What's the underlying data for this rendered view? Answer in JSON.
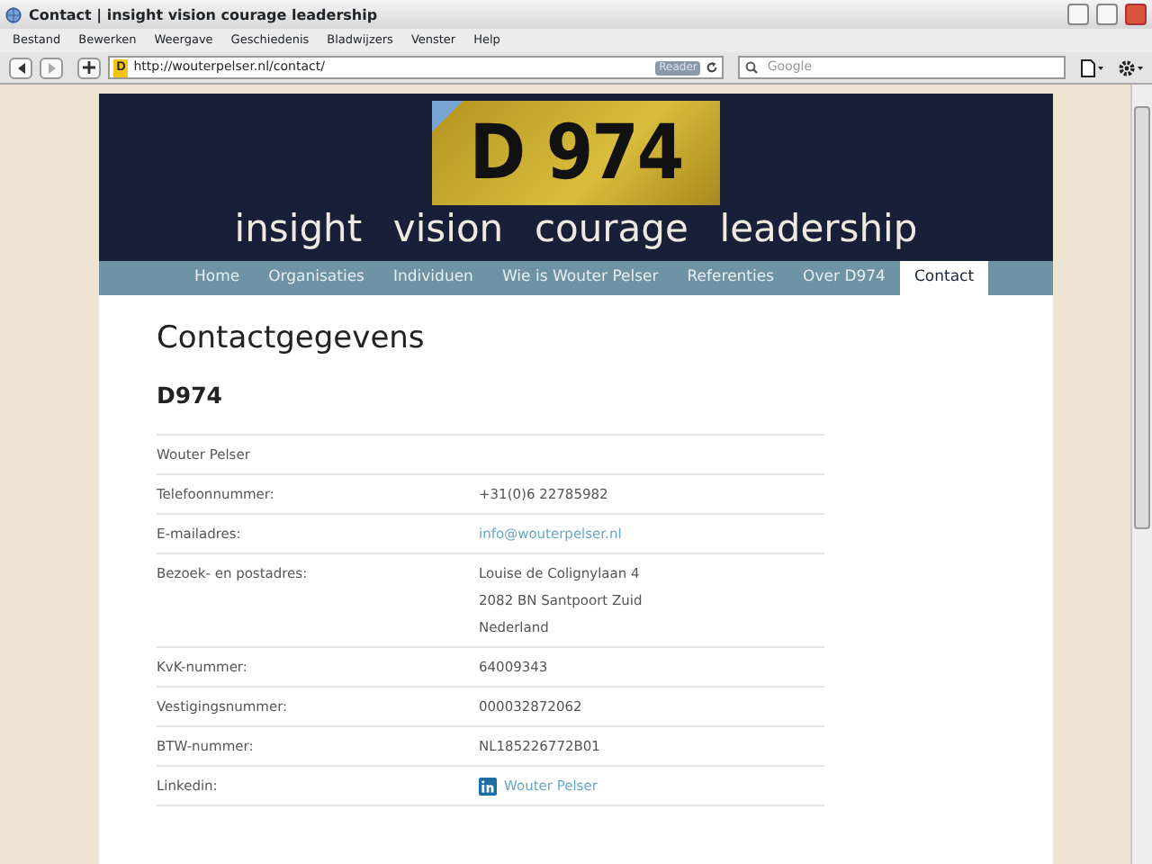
{
  "window": {
    "title": "Contact | insight  vision  courage  leadership"
  },
  "menu": [
    "Bestand",
    "Bewerken",
    "Weergave",
    "Geschiedenis",
    "Bladwijzers",
    "Venster",
    "Help"
  ],
  "toolbar": {
    "site_letter": "D",
    "url": "http://wouterpelser.nl/contact/",
    "reader": "Reader",
    "search_placeholder": "Google"
  },
  "header": {
    "logo_text": "D 974",
    "tagline": "insight  vision  courage  leadership"
  },
  "nav": [
    {
      "label": "Home",
      "selected": false
    },
    {
      "label": "Organisaties",
      "selected": false
    },
    {
      "label": "Individuen",
      "selected": false
    },
    {
      "label": "Wie is Wouter Pelser",
      "selected": false
    },
    {
      "label": "Referenties",
      "selected": false
    },
    {
      "label": "Over D974",
      "selected": false
    },
    {
      "label": "Contact",
      "selected": true
    }
  ],
  "content": {
    "heading": "Contactgegevens",
    "subheading": "D974",
    "rows": [
      {
        "label": "Wouter Pelser"
      },
      {
        "label": "Telefoonnummer:",
        "kind": "text",
        "values": [
          "+31(0)6 22785982"
        ]
      },
      {
        "label": "E-mailadres:",
        "kind": "link",
        "values": [
          "info@wouterpelser.nl"
        ]
      },
      {
        "label": "Bezoek- en postadres:",
        "kind": "text",
        "values": [
          "Louise de Colignylaan 4",
          "2082 BN Santpoort Zuid",
          "Nederland"
        ]
      },
      {
        "label": "KvK-nummer:",
        "kind": "text",
        "values": [
          "64009343"
        ]
      },
      {
        "label": "Vestigingsnummer:",
        "kind": "text",
        "values": [
          "000032872062"
        ]
      },
      {
        "label": "BTW-nummer:",
        "kind": "text",
        "values": [
          "NL185226772B01"
        ]
      },
      {
        "label": "Linkedin:",
        "kind": "profile",
        "values": [
          "Wouter Pelser"
        ]
      }
    ]
  }
}
